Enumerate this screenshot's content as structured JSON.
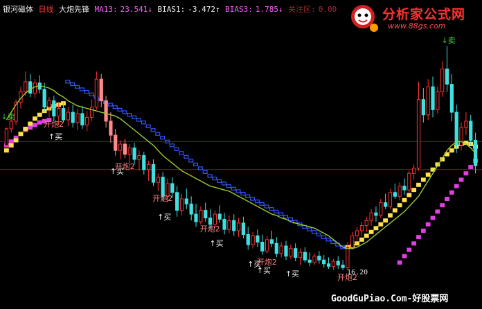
{
  "header": {
    "stock_name": "银河磁体",
    "period": "日线",
    "indicator_name": "大炮先锋",
    "ma13_label": "MA13:",
    "ma13_value": "23.541↓",
    "bias1_label": "BIAS1:",
    "bias1_value": "-3.472↑",
    "bias3_label": "BIAS3:",
    "bias3_value": "1.785↓",
    "zone_label": "关注区:",
    "zone_value": "0.00"
  },
  "colors": {
    "up": "#ff3333",
    "down": "#40e0e0",
    "salmon": "#ff8a8a",
    "ma13": "#9acd32",
    "upper": "#3355ff",
    "yellow": "#ffe14a",
    "magenta": "#e040e0",
    "refline": "#8b1a1a",
    "buy": "#f0f0f0",
    "cannon": "#ff7f7f",
    "sell": "#40d040"
  },
  "signals": {
    "buy_text": "↑买",
    "cannon_text": "开炮2",
    "sell_text": "↓卖",
    "sell_top_text": "卖"
  },
  "low_tag": "16.20",
  "logo": {
    "title": "分析家公式网",
    "url": "www.88gs.com"
  },
  "footer": "GoodGuPiao.Com-好股票网",
  "chart_data": {
    "type": "candlestick",
    "title": "",
    "xlabel": "",
    "ylabel": "",
    "ylim": [
      15.0,
      36.0
    ],
    "grid": false,
    "reference_lines": [
      26.3,
      24.1
    ],
    "sell_markers_index": [
      0,
      93
    ],
    "buy_markers_index": [
      10,
      23,
      33,
      44,
      52,
      54,
      60
    ],
    "cannon_markers_index": [
      9,
      24,
      32,
      42,
      54,
      71
    ],
    "low_marker": {
      "index": 71,
      "value": 16.2
    },
    "series": [
      {
        "name": "MA13",
        "values": [
          28.0,
          28.6,
          29.2,
          29.7,
          30.1,
          30.4,
          30.6,
          30.7,
          30.6,
          30.5,
          30.3,
          30.0,
          29.8,
          29.5,
          29.3,
          29.1,
          29.0,
          28.9,
          28.8,
          28.7,
          28.6,
          28.5,
          28.4,
          28.3,
          28.1,
          27.8,
          27.5,
          27.2,
          26.9,
          26.6,
          26.3,
          26.0,
          25.6,
          25.2,
          24.9,
          24.6,
          24.3,
          24.0,
          23.8,
          23.6,
          23.4,
          23.2,
          23.0,
          22.8,
          22.7,
          22.6,
          22.5,
          22.4,
          22.2,
          22.0,
          21.8,
          21.6,
          21.4,
          21.2,
          21.0,
          20.8,
          20.6,
          20.5,
          20.3,
          20.2,
          20.0,
          19.9,
          19.8,
          19.7,
          19.6,
          19.5,
          19.3,
          19.1,
          18.9,
          18.6,
          18.3,
          18.0,
          17.9,
          17.9,
          18.0,
          18.2,
          18.4,
          18.7,
          19.0,
          19.3,
          19.6,
          19.9,
          20.2,
          20.5,
          20.8,
          21.2,
          21.6,
          22.0,
          22.6,
          23.2,
          23.8,
          24.4,
          25.0,
          25.6,
          26.0,
          26.3,
          26.3,
          26.1,
          25.8,
          25.4
        ]
      },
      {
        "name": "Upper",
        "values": [
          null,
          null,
          null,
          null,
          null,
          null,
          null,
          null,
          null,
          null,
          null,
          null,
          null,
          31.0,
          30.8,
          30.6,
          30.4,
          30.2,
          30.0,
          29.8,
          29.6,
          29.4,
          29.2,
          29.0,
          28.8,
          28.6,
          28.4,
          28.2,
          28.0,
          27.8,
          27.5,
          27.2,
          26.9,
          26.6,
          26.3,
          26.0,
          25.7,
          25.4,
          25.1,
          24.8,
          24.5,
          24.2,
          23.9,
          23.6,
          23.4,
          23.2,
          23.0,
          22.8,
          22.6,
          22.4,
          22.2,
          22.0,
          21.8,
          21.6,
          21.4,
          21.2,
          21.0,
          20.8,
          20.6,
          20.4,
          20.2,
          20.0,
          19.8,
          19.6,
          19.4,
          19.2,
          19.0,
          18.8,
          18.6,
          18.4,
          18.2,
          18.0,
          null,
          null,
          null,
          null,
          null,
          null,
          null,
          null,
          null,
          null,
          null,
          null,
          null,
          null,
          null,
          null,
          null,
          null,
          null,
          null,
          null,
          null,
          null,
          null,
          null,
          null,
          null,
          null
        ]
      },
      {
        "name": "Support",
        "values": [
          25.6,
          26.0,
          26.4,
          26.9,
          27.3,
          27.7,
          28.1,
          28.4,
          28.7,
          28.9,
          29.1,
          29.2,
          29.3,
          null,
          null,
          null,
          null,
          null,
          null,
          null,
          null,
          null,
          null,
          null,
          null,
          null,
          null,
          null,
          null,
          null,
          null,
          null,
          null,
          null,
          null,
          null,
          null,
          null,
          null,
          null,
          null,
          null,
          null,
          null,
          null,
          null,
          null,
          null,
          null,
          null,
          null,
          null,
          null,
          null,
          null,
          null,
          null,
          null,
          null,
          null,
          null,
          null,
          null,
          null,
          null,
          null,
          null,
          null,
          null,
          null,
          null,
          null,
          18.0,
          18.1,
          18.3,
          18.6,
          18.9,
          19.2,
          19.5,
          19.8,
          20.1,
          20.5,
          20.9,
          21.3,
          21.7,
          22.1,
          22.5,
          22.9,
          23.3,
          23.7,
          24.1,
          24.5,
          24.9,
          25.3,
          25.6,
          25.9,
          26.1,
          26.2,
          26.1,
          25.9
        ]
      },
      {
        "name": "Support2",
        "values": [
          26.0,
          26.3,
          26.6,
          26.9,
          27.2,
          27.4,
          27.6,
          27.8,
          27.9,
          28.0,
          null,
          null,
          null,
          null,
          null,
          null,
          null,
          null,
          null,
          null,
          null,
          null,
          null,
          null,
          null,
          null,
          null,
          null,
          null,
          null,
          null,
          null,
          null,
          null,
          null,
          null,
          null,
          null,
          null,
          null,
          null,
          null,
          null,
          null,
          null,
          null,
          null,
          null,
          null,
          null,
          null,
          null,
          null,
          null,
          null,
          null,
          null,
          null,
          null,
          null,
          null,
          null,
          null,
          null,
          null,
          null,
          null,
          null,
          null,
          null,
          null,
          null,
          null,
          null,
          null,
          null,
          null,
          null,
          null,
          null,
          null,
          null,
          null,
          16.8,
          17.3,
          17.8,
          18.3,
          18.8,
          19.3,
          19.8,
          20.3,
          20.8,
          21.3,
          21.8,
          22.3,
          22.8,
          23.3,
          23.8,
          24.3,
          24.8
        ]
      },
      {
        "name": "Price",
        "values": [
          [
            26.0,
            27.4,
            25.8,
            27.3
          ],
          [
            27.3,
            28.2,
            27.0,
            27.9
          ],
          [
            27.9,
            29.6,
            27.6,
            29.4
          ],
          [
            29.4,
            30.6,
            28.9,
            30.2
          ],
          [
            30.2,
            31.8,
            29.9,
            31.0
          ],
          [
            31.0,
            31.6,
            29.8,
            30.1
          ],
          [
            30.1,
            31.2,
            29.7,
            30.9
          ],
          [
            30.9,
            31.5,
            30.1,
            30.4
          ],
          [
            30.4,
            30.9,
            28.6,
            29.0
          ],
          [
            29.0,
            29.8,
            28.2,
            29.5
          ],
          [
            29.5,
            29.9,
            27.9,
            28.3
          ],
          [
            28.3,
            29.3,
            27.6,
            28.9
          ],
          [
            28.9,
            29.4,
            27.8,
            28.0
          ],
          [
            28.0,
            29.0,
            27.5,
            28.6
          ],
          [
            28.6,
            29.2,
            27.4,
            27.8
          ],
          [
            27.8,
            28.9,
            27.2,
            28.5
          ],
          [
            28.5,
            29.1,
            27.3,
            27.6
          ],
          [
            27.6,
            28.7,
            27.1,
            28.2
          ],
          [
            28.2,
            29.6,
            27.9,
            29.0
          ],
          [
            29.0,
            31.8,
            28.8,
            31.2
          ],
          [
            31.2,
            31.6,
            29.0,
            29.5
          ],
          [
            29.5,
            29.9,
            27.4,
            27.9
          ],
          [
            27.9,
            28.6,
            26.2,
            26.8
          ],
          [
            26.8,
            27.3,
            25.2,
            25.6
          ],
          [
            25.6,
            26.4,
            24.9,
            26.1
          ],
          [
            26.1,
            26.5,
            25.0,
            25.3
          ],
          [
            25.3,
            26.1,
            24.6,
            25.8
          ],
          [
            25.8,
            26.2,
            24.5,
            24.9
          ],
          [
            24.9,
            25.6,
            24.0,
            25.2
          ],
          [
            25.2,
            25.5,
            23.7,
            24.1
          ],
          [
            24.1,
            24.8,
            23.2,
            24.5
          ],
          [
            24.5,
            24.9,
            22.8,
            23.1
          ],
          [
            23.1,
            23.8,
            22.4,
            23.5
          ],
          [
            23.5,
            23.9,
            21.6,
            22.0
          ],
          [
            22.0,
            23.4,
            21.5,
            23.0
          ],
          [
            23.0,
            23.5,
            21.9,
            22.3
          ],
          [
            22.3,
            22.8,
            20.4,
            20.9
          ],
          [
            20.9,
            22.2,
            20.5,
            21.8
          ],
          [
            21.8,
            22.6,
            21.0,
            21.4
          ],
          [
            21.4,
            22.0,
            20.1,
            20.6
          ],
          [
            20.6,
            21.4,
            19.6,
            20.0
          ],
          [
            20.0,
            21.2,
            19.8,
            20.9
          ],
          [
            20.9,
            21.5,
            20.0,
            20.3
          ],
          [
            20.3,
            21.0,
            19.4,
            19.8
          ],
          [
            19.8,
            20.9,
            19.5,
            20.6
          ],
          [
            20.6,
            21.3,
            19.9,
            20.2
          ],
          [
            20.2,
            20.7,
            19.0,
            19.4
          ],
          [
            19.4,
            20.5,
            19.1,
            20.1
          ],
          [
            20.1,
            20.6,
            18.9,
            19.3
          ],
          [
            19.3,
            20.3,
            18.8,
            19.9
          ],
          [
            19.9,
            20.4,
            18.7,
            19.0
          ],
          [
            19.0,
            19.6,
            17.8,
            18.2
          ],
          [
            18.2,
            19.2,
            17.9,
            18.9
          ],
          [
            18.9,
            19.4,
            18.0,
            18.4
          ],
          [
            18.4,
            19.0,
            17.4,
            17.7
          ],
          [
            17.7,
            18.9,
            17.5,
            18.6
          ],
          [
            18.6,
            19.3,
            18.0,
            18.3
          ],
          [
            18.3,
            18.8,
            17.2,
            17.5
          ],
          [
            17.5,
            18.4,
            17.2,
            18.1
          ],
          [
            18.1,
            18.5,
            17.0,
            17.3
          ],
          [
            17.3,
            18.2,
            17.1,
            17.9
          ],
          [
            17.9,
            18.3,
            16.9,
            17.2
          ],
          [
            17.2,
            17.9,
            16.6,
            17.6
          ],
          [
            17.6,
            18.0,
            16.8,
            17.0
          ],
          [
            17.0,
            17.6,
            16.5,
            16.8
          ],
          [
            16.8,
            17.5,
            16.6,
            17.3
          ],
          [
            17.3,
            17.7,
            16.7,
            17.0
          ],
          [
            17.0,
            17.4,
            16.4,
            16.7
          ],
          [
            16.7,
            17.2,
            16.3,
            16.5
          ],
          [
            16.5,
            17.1,
            16.2,
            16.9
          ],
          [
            16.9,
            17.3,
            16.3,
            16.6
          ],
          [
            16.6,
            17.0,
            16.2,
            16.4
          ],
          [
            16.4,
            18.4,
            16.2,
            18.0
          ],
          [
            18.0,
            19.2,
            17.8,
            18.9
          ],
          [
            18.9,
            19.6,
            18.5,
            19.3
          ],
          [
            19.3,
            20.0,
            18.9,
            19.7
          ],
          [
            19.7,
            20.4,
            19.2,
            20.1
          ],
          [
            20.1,
            21.0,
            19.7,
            20.7
          ],
          [
            20.7,
            21.2,
            20.0,
            20.5
          ],
          [
            20.5,
            21.8,
            20.3,
            21.5
          ],
          [
            21.5,
            22.2,
            21.0,
            21.2
          ],
          [
            21.2,
            22.6,
            21.0,
            22.3
          ],
          [
            22.3,
            23.0,
            21.8,
            22.0
          ],
          [
            22.0,
            23.1,
            21.7,
            22.8
          ],
          [
            22.8,
            23.4,
            22.1,
            22.5
          ],
          [
            22.5,
            24.0,
            22.3,
            23.8
          ],
          [
            23.8,
            24.5,
            23.3,
            24.2
          ],
          [
            24.2,
            31.0,
            24.0,
            29.6
          ],
          [
            29.6,
            30.5,
            27.8,
            28.4
          ],
          [
            28.4,
            31.2,
            28.0,
            30.6
          ],
          [
            30.6,
            31.4,
            28.2,
            28.8
          ],
          [
            28.8,
            30.6,
            28.5,
            30.2
          ],
          [
            30.2,
            32.6,
            29.8,
            32.0
          ],
          [
            32.0,
            33.8,
            30.2,
            30.8
          ],
          [
            30.8,
            31.6,
            27.9,
            28.6
          ],
          [
            28.6,
            29.2,
            25.4,
            26.0
          ],
          [
            26.0,
            27.8,
            25.6,
            27.4
          ],
          [
            27.4,
            28.6,
            26.8,
            27.9
          ],
          [
            27.9,
            28.4,
            26.0,
            26.4
          ],
          [
            26.4,
            27.0,
            23.8,
            24.4
          ]
        ]
      }
    ]
  }
}
